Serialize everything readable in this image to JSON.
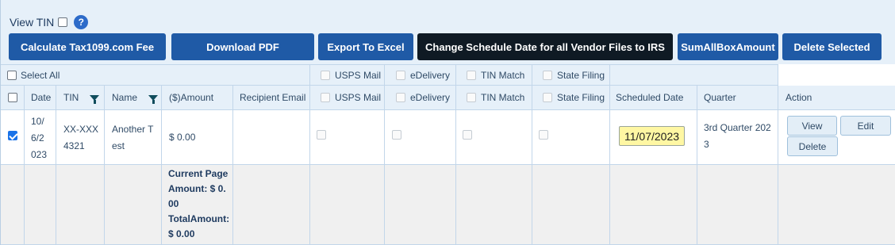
{
  "header": {
    "view_tin_label": "View TIN",
    "help_symbol": "?"
  },
  "toolbar": {
    "calculate_fee": "Calculate Tax1099.com Fee",
    "download_pdf": "Download PDF",
    "export_excel": "Export To Excel",
    "change_schedule": "Change Schedule Date for all Vendor Files to IRS",
    "sum_all_box": "SumAllBoxAmount",
    "delete_selected": "Delete Selected"
  },
  "group_header": {
    "select_all": "Select All",
    "usps_mail": "USPS Mail",
    "edelivery": "eDelivery",
    "tin_match": "TIN Match",
    "state_filing": "State Filing"
  },
  "columns": {
    "date": "Date",
    "tin": "TIN",
    "name": "Name",
    "amount": "($)Amount",
    "recipient_email": "Recipient Email",
    "usps_mail": "USPS Mail",
    "edelivery": "eDelivery",
    "tin_match": "TIN Match",
    "state_filing": "State Filing",
    "scheduled_date": "Scheduled Date",
    "quarter": "Quarter",
    "action": "Action"
  },
  "row": {
    "date_l1": "10/",
    "date_l2": "6/2",
    "date_l3": "023",
    "tin_l1": "XX-XXX",
    "tin_l2": "4321",
    "name_l1": "Another T",
    "name_l2": "est",
    "amount": "$ 0.00",
    "scheduled_date": "11/07/2023",
    "quarter_l1": "3rd Quarter 202",
    "quarter_l2": "3",
    "view": "View",
    "edit": "Edit",
    "delete": "Delete"
  },
  "totals": {
    "l1": "Current Page",
    "l2": "Amount: $ 0.",
    "l3": "00",
    "l4": "TotalAmount:",
    "l5": "$ 0.00"
  }
}
